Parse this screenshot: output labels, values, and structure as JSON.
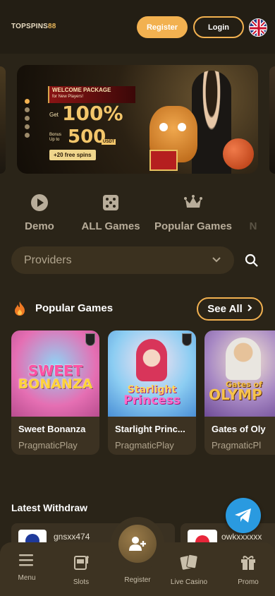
{
  "header": {
    "logo_text": "TOPSPINS",
    "logo_num": "88",
    "register_label": "Register",
    "login_label": "Login",
    "language_flag": "uk-flag-icon"
  },
  "banner": {
    "welcome_title": "WELCOME PACKAGE",
    "welcome_sub": "for New Players!",
    "get_label": "Get",
    "percent": "100%",
    "bonus_label": "Bonus",
    "upto_label": "Up to",
    "amount": "500",
    "currency": "USDT",
    "spins": "+20 free spins",
    "slides_total": 5,
    "active_slide": 1
  },
  "categories": [
    {
      "label": "Demo",
      "icon": "play-icon"
    },
    {
      "label": "ALL Games",
      "icon": "dice-icon"
    },
    {
      "label": "Popular Games",
      "icon": "crown-icon"
    },
    {
      "label": "N",
      "icon": ""
    }
  ],
  "providers": {
    "label": "Providers"
  },
  "popular": {
    "title": "Popular Games",
    "see_all": "See All",
    "games": [
      {
        "name": "Sweet Bonanza",
        "provider": "PragmaticPlay",
        "art_line1": "SWEET",
        "art_line2": "BONANZA"
      },
      {
        "name": "Starlight Princ...",
        "provider": "PragmaticPlay",
        "art_line1": "Starlight",
        "art_line2": "Princess"
      },
      {
        "name": "Gates of Oly",
        "provider": "PragmaticPl",
        "art_line1": "Gates of",
        "art_line2": "OLYMP"
      }
    ]
  },
  "withdraw": {
    "title": "Latest Withdraw",
    "items": [
      {
        "user": "gnsxx474"
      },
      {
        "user": "owkxxxxxx"
      }
    ]
  },
  "bottom_nav": {
    "items": [
      {
        "label": "Menu",
        "icon": "menu-icon"
      },
      {
        "label": "Slots",
        "icon": "slot-machine-icon"
      },
      {
        "label": "Register",
        "icon": "add-user-icon"
      },
      {
        "label": "Live Casino",
        "icon": "cards-icon"
      },
      {
        "label": "Promo",
        "icon": "gift-icon"
      }
    ]
  },
  "colors": {
    "accent": "#f2b150",
    "background": "#2a2418",
    "telegram": "#2a9ae0"
  }
}
